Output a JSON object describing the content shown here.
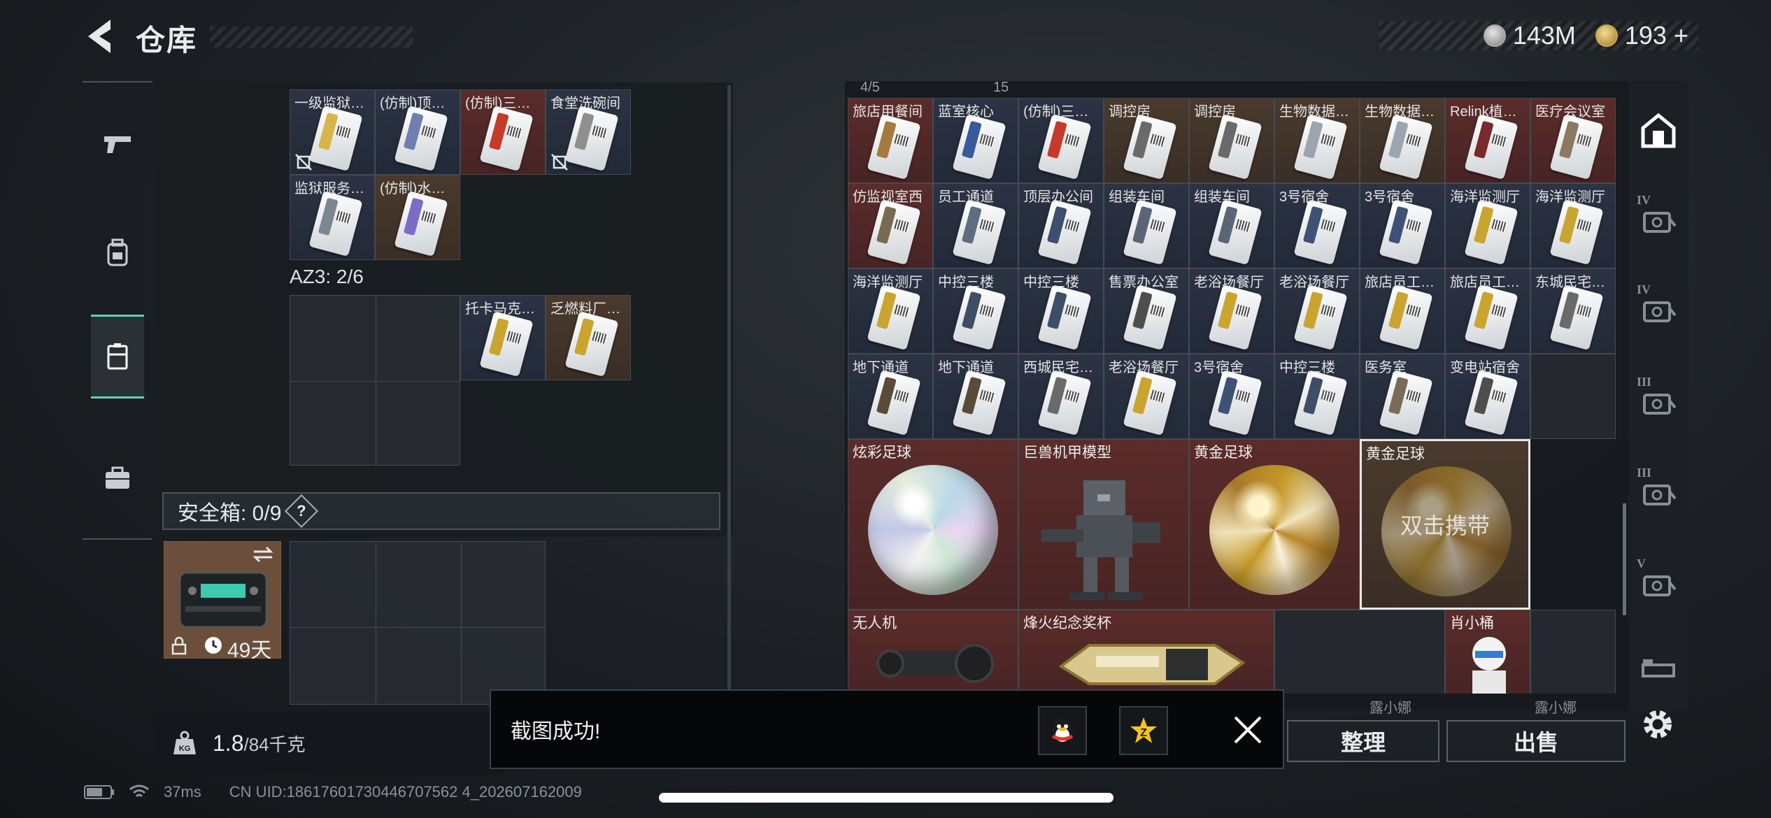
{
  "header": {
    "back_label": "back",
    "title": "仓库",
    "currencies": [
      {
        "icon": "silver-coin-icon",
        "value": "143M"
      },
      {
        "icon": "gold-coin-icon",
        "value": "193"
      }
    ],
    "add_symbol": "+"
  },
  "left_nav": {
    "items": [
      {
        "name": "weapon",
        "icon": "pistol-icon"
      },
      {
        "name": "armor",
        "icon": "backpack-icon"
      },
      {
        "name": "storage",
        "icon": "container-icon",
        "active": true
      },
      {
        "name": "kit",
        "icon": "briefcase-icon"
      }
    ]
  },
  "left_panel": {
    "keycards_top": [
      {
        "label": "一级监狱…",
        "color": "#d8b54a",
        "bg": "blue",
        "no_carry": true
      },
      {
        "label": "(仿制)顶…",
        "color": "#6f7fb0",
        "bg": "blue"
      },
      {
        "label": "(仿制)三…",
        "color": "#c63a2a",
        "bg": "red"
      },
      {
        "label": "食堂洗碗间",
        "color": "#8f8f8f",
        "bg": "blue",
        "no_carry": true
      },
      {
        "label": "监狱服务…",
        "color": "#7c8794",
        "bg": "blue"
      },
      {
        "label": "(仿制)水…",
        "color": "#7b6cc8",
        "bg": "brown"
      }
    ],
    "az3_label": "AZ3: 2/6",
    "az3_items": [
      {
        "label": "托卡马克…",
        "color": "#c9a530",
        "bg": "blue"
      },
      {
        "label": "乏燃料厂…",
        "color": "#c9a530",
        "bg": "brown"
      }
    ],
    "safe_label": "安全箱: 0/9",
    "help": "?",
    "safebox_days": "49天",
    "weight_value": "1.8",
    "weight_max": "/84千克"
  },
  "right_panel": {
    "top_partial": [
      "4/5",
      "15"
    ],
    "keycards": [
      {
        "label": "旅店用餐间",
        "color": "#a57a3e",
        "bg": "red"
      },
      {
        "label": "蓝室核心",
        "color": "#375a9a",
        "bg": "blue"
      },
      {
        "label": "(仿制)三…",
        "color": "#c63a2a",
        "bg": "blue"
      },
      {
        "label": "调控房",
        "color": "#6a6a6a",
        "bg": "brown"
      },
      {
        "label": "调控房",
        "color": "#6a6a6a",
        "bg": "brown"
      },
      {
        "label": "生物数据…",
        "color": "#9aa5b0",
        "bg": "brown"
      },
      {
        "label": "生物数据…",
        "color": "#9aa5b0",
        "bg": "brown"
      },
      {
        "label": "Relink植…",
        "color": "#7a2a2a",
        "bg": "red"
      },
      {
        "label": "医疗会议室",
        "color": "#8a7a60",
        "bg": "red"
      },
      {
        "label": "仿监视室西",
        "color": "#7a6a50",
        "bg": "red"
      },
      {
        "label": "员工通道",
        "color": "#5d6e80",
        "bg": "blue"
      },
      {
        "label": "顶层办公间",
        "color": "#3d4e6e",
        "bg": "blue"
      },
      {
        "label": "组装车间",
        "color": "#5a6678",
        "bg": "blue"
      },
      {
        "label": "组装车间",
        "color": "#5a6678",
        "bg": "blue"
      },
      {
        "label": "3号宿舍",
        "color": "#3e5276",
        "bg": "blue"
      },
      {
        "label": "3号宿舍",
        "color": "#3e5276",
        "bg": "blue"
      },
      {
        "label": "海洋监测厅",
        "color": "#c9a530",
        "bg": "blue"
      },
      {
        "label": "海洋监测厅",
        "color": "#c9a530",
        "bg": "blue"
      },
      {
        "label": "海洋监测厅",
        "color": "#c9a530",
        "bg": "blue"
      },
      {
        "label": "中控三楼",
        "color": "#3e4e66",
        "bg": "blue"
      },
      {
        "label": "中控三楼",
        "color": "#3e4e66",
        "bg": "blue"
      },
      {
        "label": "售票办公室",
        "color": "#4e4e4e",
        "bg": "blue"
      },
      {
        "label": "老浴场餐厅",
        "color": "#c9a530",
        "bg": "blue"
      },
      {
        "label": "老浴场餐厅",
        "color": "#c9a530",
        "bg": "blue"
      },
      {
        "label": "旅店员工…",
        "color": "#c9a530",
        "bg": "blue"
      },
      {
        "label": "旅店员工…",
        "color": "#c9a530",
        "bg": "blue"
      },
      {
        "label": "东城民宅…",
        "color": "#6a6a6a",
        "bg": "blue"
      },
      {
        "label": "地下通道",
        "color": "#5a4a3a",
        "bg": "blue"
      },
      {
        "label": "地下通道",
        "color": "#5a4a3a",
        "bg": "blue"
      },
      {
        "label": "西城民宅…",
        "color": "#6a6a6a",
        "bg": "blue"
      },
      {
        "label": "老浴场餐厅",
        "color": "#c9a530",
        "bg": "blue"
      },
      {
        "label": "3号宿舍",
        "color": "#3e5276",
        "bg": "blue"
      },
      {
        "label": "中控三楼",
        "color": "#3e4e66",
        "bg": "blue"
      },
      {
        "label": "医务室",
        "color": "#7a6a5a",
        "bg": "blue"
      },
      {
        "label": "变电站宿舍",
        "color": "#4e4e4e",
        "bg": "blue"
      }
    ],
    "big_items": [
      {
        "label": "炫彩足球",
        "kind": "holo-ball",
        "bg": "red"
      },
      {
        "label": "巨兽机甲模型",
        "kind": "mech",
        "bg": "red"
      },
      {
        "label": "黄金足球",
        "kind": "gold-ball",
        "bg": "red"
      },
      {
        "label": "黄金足球",
        "kind": "gold-ball",
        "bg": "brown",
        "selected": true
      }
    ],
    "carry_hint": "双击携带",
    "bottom_items": [
      {
        "label": "无人机",
        "kind": "drone"
      },
      {
        "label": "烽火纪念奖杯",
        "kind": "trophy"
      },
      {
        "label": "肖小桶",
        "kind": "figure"
      }
    ],
    "ghost_labels": [
      "露小娜",
      "露小娜"
    ],
    "sort_button": "整理",
    "sell_button": "出售"
  },
  "right_nav": {
    "items": [
      "home-icon",
      "tier-4-safe-icon",
      "tier-4-safe-icon",
      "tier-3-safe-icon",
      "tier-3-safe-icon",
      "tier-5-safe-icon",
      "bed-icon"
    ],
    "tiers": [
      "",
      "IV",
      "IV",
      "III",
      "III",
      "V",
      ""
    ]
  },
  "toast": {
    "message": "截图成功!",
    "share_qq": "qq-icon",
    "share_qzone": "qzone-icon"
  },
  "status_bar": {
    "ping": "37ms",
    "uid": "CN UID:18617601730446707562 4_202607162009"
  }
}
